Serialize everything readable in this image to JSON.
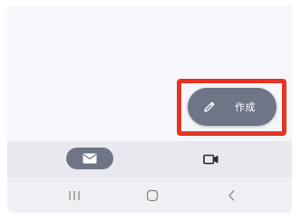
{
  "compose_button": {
    "label": "作成",
    "icon": "pencil-icon"
  },
  "bottom_nav": {
    "items": [
      {
        "name": "mail",
        "icon": "mail-icon",
        "selected": true
      },
      {
        "name": "meet",
        "icon": "video-camera-icon",
        "selected": false
      }
    ]
  },
  "system_nav": {
    "buttons": [
      {
        "name": "recent-apps",
        "icon": "recent-apps-icon"
      },
      {
        "name": "home",
        "icon": "home-icon"
      },
      {
        "name": "back",
        "icon": "back-icon"
      }
    ]
  },
  "colors": {
    "fab_background": "#6e7587",
    "highlight": "#e43524",
    "nav_background": "#e8e9ee",
    "screen_background": "#f7f7fb",
    "icon_dark": "#2b2b2b",
    "system_icon": "#888888"
  }
}
